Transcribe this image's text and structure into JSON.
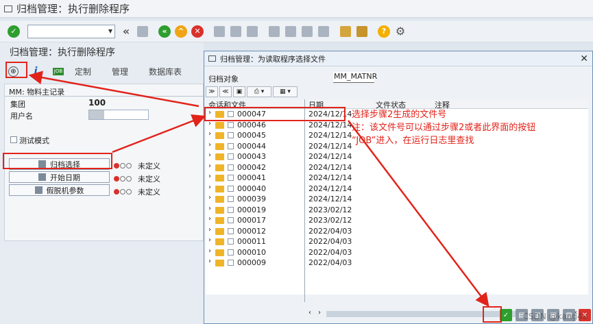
{
  "window": {
    "title": "归档管理：执行删除程序"
  },
  "toolbar": {
    "command_field": "",
    "colors": {
      "green": "#2e9e2e",
      "orange": "#f0a515",
      "red": "#d9312b",
      "help": "#f4b000"
    }
  },
  "main": {
    "screen_title": "归档管理：执行删除程序",
    "app_toolbar": {
      "job_label": "JOB",
      "tabs": [
        "定制",
        "管理",
        "数据库表"
      ]
    },
    "group_title": "MM: 物料主记录",
    "client_label": "集团",
    "client_value": "100",
    "user_label": "用户名",
    "user_value": "",
    "test_mode_label": "测试模式",
    "buttons": [
      {
        "label": "归档选择",
        "status": "未定义"
      },
      {
        "label": "开始日期",
        "status": "未定义"
      },
      {
        "label": "假脱机参数",
        "status": "未定义"
      }
    ]
  },
  "dialog": {
    "title": "归档管理：为读取程序选择文件",
    "archive_object_label": "归档对象",
    "archive_object_value": "MM_MATNR",
    "columns": [
      "会话和文件",
      "日期",
      "文件状态",
      "注释"
    ],
    "rows": [
      {
        "session": "000047",
        "date": "2024/12/14"
      },
      {
        "session": "000046",
        "date": "2024/12/14"
      },
      {
        "session": "000045",
        "date": "2024/12/14"
      },
      {
        "session": "000044",
        "date": "2024/12/14"
      },
      {
        "session": "000043",
        "date": "2024/12/14"
      },
      {
        "session": "000042",
        "date": "2024/12/14"
      },
      {
        "session": "000041",
        "date": "2024/12/14"
      },
      {
        "session": "000040",
        "date": "2024/12/14"
      },
      {
        "session": "000039",
        "date": "2024/12/14"
      },
      {
        "session": "000019",
        "date": "2023/02/12"
      },
      {
        "session": "000017",
        "date": "2023/02/12"
      },
      {
        "session": "000012",
        "date": "2022/04/03"
      },
      {
        "session": "000011",
        "date": "2022/04/03"
      },
      {
        "session": "000010",
        "date": "2022/04/03"
      },
      {
        "session": "000009",
        "date": "2022/04/03"
      }
    ]
  },
  "annotations": {
    "line1": "选择步骤2生成的文件号",
    "line2": "注：该文件号可以通过步骤2或者此界面的按钮",
    "line3": "“JOB”进入，在运行日志里查找",
    "color": "#e2231a"
  },
  "watermark": "CSDN @kang4e"
}
